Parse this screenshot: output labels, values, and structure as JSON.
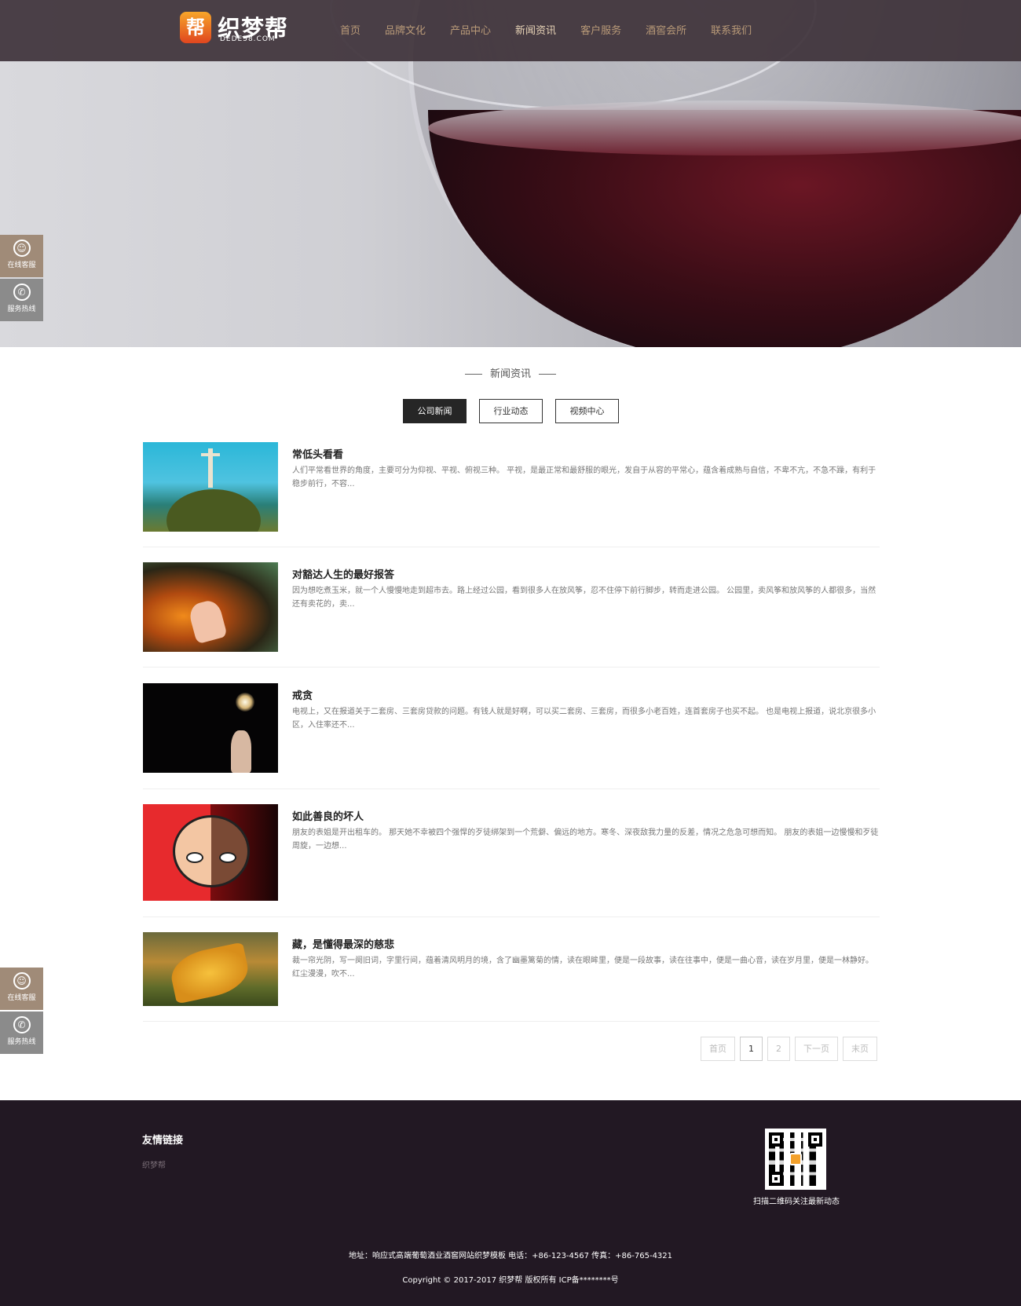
{
  "header": {
    "logo_badge": "帮",
    "logo_text": "织梦帮",
    "logo_sub": "DEDE58.COM",
    "nav": [
      {
        "label": "首页"
      },
      {
        "label": "品牌文化"
      },
      {
        "label": "产品中心"
      },
      {
        "label": "新闻资讯",
        "active": true
      },
      {
        "label": "客户服务"
      },
      {
        "label": "酒窖会所"
      },
      {
        "label": "联系我们"
      }
    ]
  },
  "floating": {
    "kefu_label": "在线客服",
    "hotline_label": "服务热线"
  },
  "section": {
    "title": "新闻资讯",
    "tabs": [
      {
        "label": "公司新闻",
        "active": true
      },
      {
        "label": "行业动态"
      },
      {
        "label": "视频中心"
      }
    ]
  },
  "news": [
    {
      "title": "常低头看看",
      "desc": "人们平常看世界的角度，主要可分为仰视、平视、俯视三种。 平视，是最正常和最舒服的眼光，发自于从容的平常心，蕴含着成熟与自信，不卑不亢，不急不躁，有利于稳步前行，不容..."
    },
    {
      "title": "对豁达人生的最好报答",
      "desc": "因为想吃煮玉米，就一个人慢慢地走到超市去。路上经过公园，看到很多人在放风筝，忍不住停下前行脚步，转而走进公园。 公园里，卖风筝和放风筝的人都很多，当然还有卖花的，卖..."
    },
    {
      "title": "戒贪",
      "desc": "电视上，又在报道关于二套房、三套房贷款的问题。有钱人就是好啊，可以买二套房、三套房，而很多小老百姓，连首套房子也买不起。 也是电视上报道，说北京很多小区，入住率还不..."
    },
    {
      "title": "如此善良的坏人",
      "desc": "朋友的表姐是开出租车的。 那天她不幸被四个强悍的歹徒绑架到一个荒僻、偏远的地方。寒冬、深夜敌我力量的反差，情况之危急可想而知。 朋友的表姐一边慢慢和歹徒周旋，一边想..."
    },
    {
      "title": "藏，是懂得最深的慈悲",
      "desc": "裁一帘光阴，写一阕旧词，字里行间，蕴着清风明月的境，含了幽墨篱菊的情，读在眼眸里，便是一段故事，读在往事中，便是一曲心音，读在岁月里，便是一林静好。 红尘漫漫，吹不..."
    }
  ],
  "pagination": {
    "first": "首页",
    "pages": [
      "1",
      "2"
    ],
    "current": "1",
    "next": "下一页",
    "last": "末页"
  },
  "footer": {
    "links_title": "友情链接",
    "links": [
      "织梦帮"
    ],
    "qr_caption": "扫描二维码关注最新动态",
    "address": "地址：响应式高端葡萄酒业酒窖网站织梦模板 电话：+86-123-4567 传真：+86-765-4321",
    "copyright": "Copyright © 2017-2017 织梦帮 版权所有  ICP备********号"
  },
  "colors": {
    "header_bg": "#3e323a",
    "nav_text": "#b99a78",
    "footer_bg": "#221823",
    "tab_active_bg": "#262626",
    "float_kefu": "#a08b78",
    "float_hotline": "#8b8b8b"
  }
}
